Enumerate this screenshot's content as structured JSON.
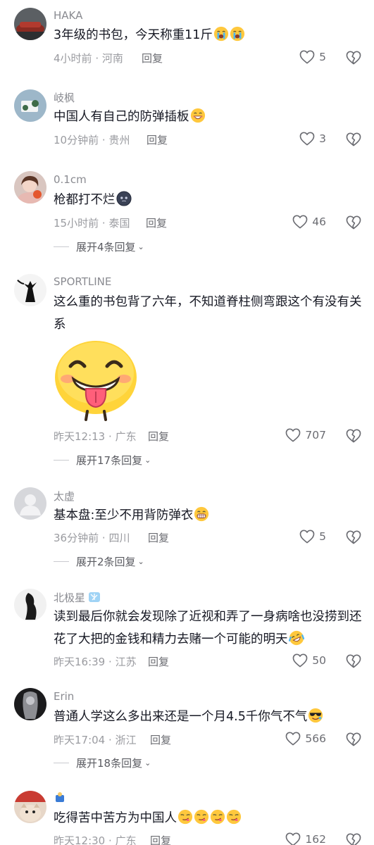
{
  "comments": [
    {
      "username": "HAKA",
      "text": "3年级的书包，今天称重11斤",
      "emojis": [
        "loudly-crying-emoji",
        "loudly-crying-emoji"
      ],
      "time": "4小时前",
      "location": "河南",
      "reply": "回复",
      "likes": "5"
    },
    {
      "username": "岐枫",
      "text": "中国人有自己的防弹插板",
      "emojis": [
        "grinning-face-emoji"
      ],
      "time": "10分钟前",
      "location": "贵州",
      "reply": "回复",
      "likes": "3"
    },
    {
      "username": "0.1cm",
      "text": "枪都打不烂",
      "emojis": [
        "dark-face-emoji"
      ],
      "time": "15小时前",
      "location": "泰国",
      "reply": "回复",
      "likes": "46",
      "expand": "展开4条回复"
    },
    {
      "username": "SPORTLINE",
      "text": "这么重的书包背了六年，不知道脊柱侧弯跟这个有没有关系",
      "sticker": "tongue-out-smile-sticker",
      "time": "昨天12:13",
      "location": "广东",
      "reply": "回复",
      "likes": "707",
      "expand": "展开17条回复"
    },
    {
      "username": "太虚",
      "text": "基本盘:至少不用背防弹衣",
      "emojis": [
        "grin-emoji"
      ],
      "time": "36分钟前",
      "location": "四川",
      "reply": "回复",
      "likes": "5",
      "expand": "展开2条回复"
    },
    {
      "username": "北极星",
      "badge": "ice-badge-icon",
      "text": "读到最后你就会发现除了近视和弄了一身病啥也没捞到还花了大把的金钱和精力去赌一个可能的明天",
      "emojis": [
        "rofl-emoji"
      ],
      "time": "昨天16:39",
      "location": "江苏",
      "reply": "回复",
      "likes": "50"
    },
    {
      "username": "Erin",
      "text": "普通人学这么多出来还是一个月4.5千你气不气",
      "emojis": [
        "sunglasses-emoji"
      ],
      "time": "昨天17:04",
      "location": "浙江",
      "reply": "回复",
      "likes": "566",
      "expand": "展开18条回复"
    },
    {
      "username": "",
      "text": "吃得苦中苦方为中国人",
      "emojis": [
        "smirk-emoji",
        "smirk-emoji",
        "smirk-emoji",
        "smirk-emoji"
      ],
      "time": "昨天12:30",
      "location": "广东",
      "reply": "回复",
      "likes": "162"
    }
  ],
  "meta_separator": "·",
  "colors": {
    "text": "#161823",
    "secondary": "#8a8b91",
    "emoji_yellow": "#ffc83d"
  },
  "icons": {
    "like": "heart-outline-icon",
    "dislike": "broken-heart-icon",
    "expand": "chevron-down-icon"
  }
}
